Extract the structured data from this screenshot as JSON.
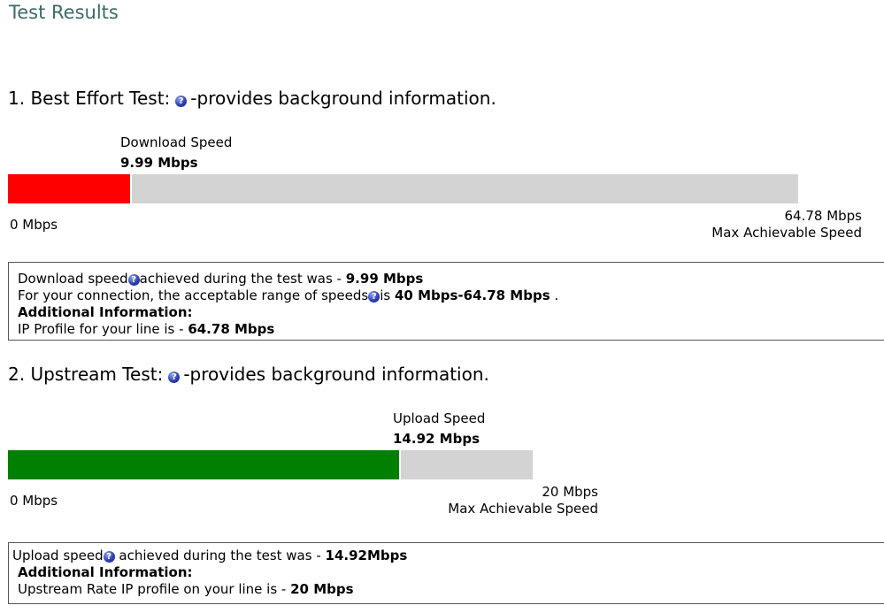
{
  "page_title": "Test Results",
  "colors": {
    "title": "#3b6b63",
    "download_fill": "#ff0000",
    "upload_fill": "#008000",
    "bar_track": "#d3d3d3"
  },
  "help_icon": "help-circle-icon",
  "best_effort": {
    "heading": "1. Best Effort Test:",
    "heading_suffix": "-provides background information.",
    "speed_label": "Download Speed",
    "speed_value": "9.99 Mbps",
    "speed_fraction": 0.1542,
    "min_label": "0 Mbps",
    "max_value": "64.78 Mbps",
    "max_caption": "Max Achievable Speed",
    "info": {
      "line1_prefix": "Download speed",
      "line1_middle": "achieved during the test was - ",
      "line1_value": "9.99 Mbps",
      "line2_prefix": "For your connection, the acceptable range of speeds",
      "line2_middle": "is ",
      "line2_value": "40 Mbps-64.78 Mbps",
      "line2_suffix": " .",
      "additional_heading": "Additional Information:",
      "line4_prefix": "IP Profile for your line is - ",
      "line4_value": "64.78 Mbps"
    }
  },
  "upstream": {
    "heading": "2. Upstream Test:",
    "heading_suffix": "-provides background information.",
    "speed_label": "Upload Speed",
    "speed_value": "14.92 Mbps",
    "speed_fraction": 0.746,
    "min_label": "0 Mbps",
    "max_value": "20 Mbps",
    "max_caption": "Max Achievable Speed",
    "info": {
      "line1_prefix": "Upload speed",
      "line1_middle": " achieved during the test was - ",
      "line1_value": "14.92Mbps",
      "additional_heading": "Additional Information:",
      "line3_prefix": "Upstream Rate IP profile on your line is - ",
      "line3_value": "20 Mbps"
    }
  }
}
